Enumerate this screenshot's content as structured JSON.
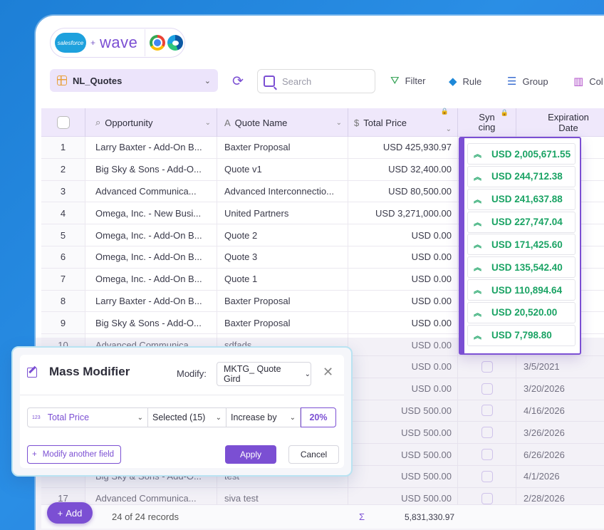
{
  "brand": {
    "salesforce": "salesforce",
    "plus": "+",
    "wave": "wave"
  },
  "toolbar": {
    "view_name": "NL_Quotes",
    "search_placeholder": "Search",
    "filter": "Filter",
    "rule": "Rule",
    "group": "Group",
    "columns": "Col"
  },
  "columns": {
    "opportunity": "Opportunity",
    "quote_name": "Quote Name",
    "total_price": "Total Price",
    "syncing_1": "Syn",
    "syncing_2": "cing",
    "expiration_1": "Expiration",
    "expiration_2": "Date"
  },
  "rows": [
    {
      "n": "1",
      "opp": "Larry Baxter - Add-On B...",
      "quote": "Baxter Proposal",
      "price": "USD 425,930.97",
      "date": ""
    },
    {
      "n": "2",
      "opp": "Big Sky & Sons - Add-O...",
      "quote": "Quote v1",
      "price": "USD 32,400.00",
      "date": ""
    },
    {
      "n": "3",
      "opp": "Advanced Communica...",
      "quote": "Advanced Interconnectio...",
      "price": "USD 80,500.00",
      "date": ""
    },
    {
      "n": "4",
      "opp": "Omega, Inc. - New Busi...",
      "quote": "United Partners",
      "price": "USD 3,271,000.00",
      "date": ""
    },
    {
      "n": "5",
      "opp": "Omega, Inc. - Add-On B...",
      "quote": "Quote 2",
      "price": "USD 0.00",
      "date": ""
    },
    {
      "n": "6",
      "opp": "Omega, Inc. - Add-On B...",
      "quote": "Quote 3",
      "price": "USD 0.00",
      "date": ""
    },
    {
      "n": "7",
      "opp": "Omega, Inc. - Add-On B...",
      "quote": "Quote 1",
      "price": "USD 0.00",
      "date": ""
    },
    {
      "n": "8",
      "opp": "Larry Baxter - Add-On B...",
      "quote": "Baxter Proposal",
      "price": "USD 0.00",
      "date": ""
    },
    {
      "n": "9",
      "opp": "Big Sky & Sons - Add-O...",
      "quote": "Baxter Proposal",
      "price": "USD 0.00",
      "date": ""
    },
    {
      "n": "10",
      "opp": "Advanced Communica...",
      "quote": "sdfads",
      "price": "USD 0.00",
      "date": ""
    },
    {
      "n": "",
      "opp": "",
      "quote": "",
      "price": "USD 0.00",
      "date": "3/5/2021"
    },
    {
      "n": "",
      "opp": "",
      "quote": "",
      "price": "USD 0.00",
      "date": "3/20/2026"
    },
    {
      "n": "",
      "opp": "",
      "quote": "",
      "price": "USD 500.00",
      "date": "4/16/2026"
    },
    {
      "n": "",
      "opp": "",
      "quote": "",
      "price": "USD 500.00",
      "date": "3/26/2026"
    },
    {
      "n": "",
      "opp": "",
      "quote": "",
      "price": "USD 500.00",
      "date": "6/26/2026"
    },
    {
      "n": "",
      "opp": "Big Sky & Sons - Add-O...",
      "quote": "test",
      "price": "USD 500.00",
      "date": "4/1/2026"
    },
    {
      "n": "17",
      "opp": "Advanced Communica...",
      "quote": "siva test",
      "price": "USD 500.00",
      "date": "2/28/2026"
    }
  ],
  "popover_values": [
    "USD 2,005,671.55",
    "USD 244,712.38",
    "USD 241,637.88",
    "USD 227,747.04",
    "USD 171,425.60",
    "USD 135,542.40",
    "USD 110,894.64",
    "USD 20,520.00",
    "USD 7,798.80"
  ],
  "footer": {
    "add_label": "Add",
    "records": "24 of 24 records",
    "sigma": "Σ",
    "sum": "5,831,330.97"
  },
  "modal": {
    "title": "Mass Modifier",
    "modify_label": "Modify:",
    "modify_value": "MKTG_ Quote Gird",
    "field_type": "123",
    "field": "Total Price",
    "selected": "Selected (15)",
    "operation": "Increase by",
    "amount": "20%",
    "another": "Modify another field",
    "apply": "Apply",
    "cancel": "Cancel"
  },
  "colors": {
    "accent": "#7b4fd3",
    "positive": "#1aa364",
    "header_bg": "#efe8fb"
  }
}
